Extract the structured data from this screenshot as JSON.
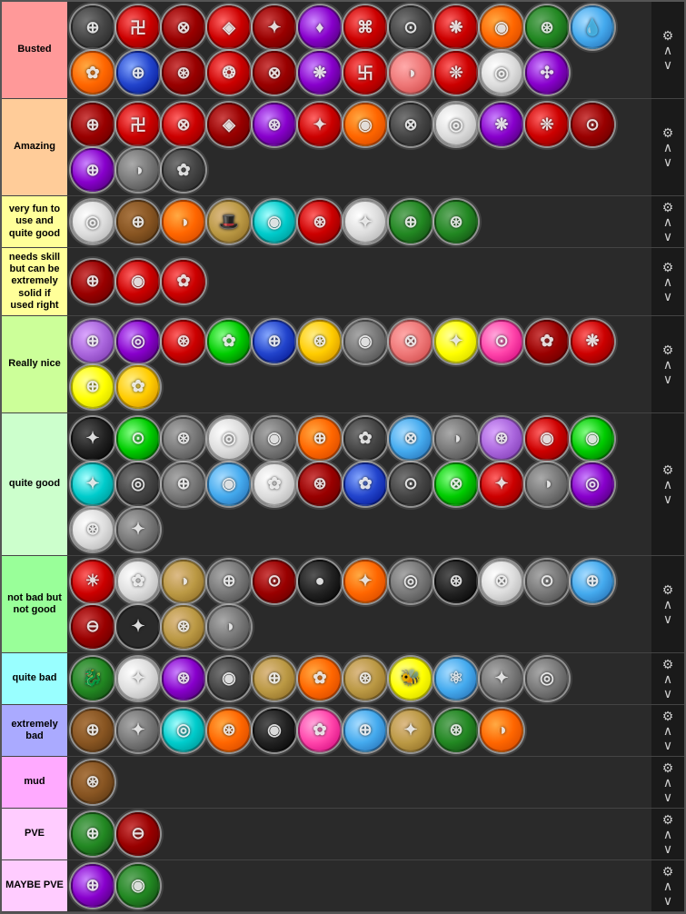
{
  "tiers": [
    {
      "id": "busted",
      "label": "Busted",
      "color": "#ff9999",
      "icons": [
        {
          "color": "ic-darkgray",
          "symbol": "⊕",
          "gear": true
        },
        {
          "color": "ic-red",
          "symbol": "卍",
          "gear": true
        },
        {
          "color": "ic-darkred",
          "symbol": "⊗",
          "gear": true
        },
        {
          "color": "ic-red",
          "symbol": "◈",
          "gear": true
        },
        {
          "color": "ic-darkred",
          "symbol": "✦",
          "gear": true
        },
        {
          "color": "ic-purple",
          "symbol": "♦",
          "gear": true
        },
        {
          "color": "ic-red",
          "symbol": "⌘",
          "gear": true
        },
        {
          "color": "ic-darkgray",
          "symbol": "⊙",
          "gear": true
        },
        {
          "color": "ic-red",
          "symbol": "❋",
          "gear": true
        },
        {
          "color": "ic-orange",
          "symbol": "◉",
          "gear": true
        },
        {
          "color": "ic-darkgreen",
          "symbol": "⊛",
          "gear": true
        },
        {
          "color": "ic-lightblue",
          "symbol": "💧",
          "gear": true
        },
        {
          "color": "ic-orange",
          "symbol": "✿",
          "gear": true
        },
        {
          "color": "ic-blue",
          "symbol": "⊕",
          "gear": true
        },
        {
          "color": "ic-darkred",
          "symbol": "⊛",
          "gear": true
        },
        {
          "color": "ic-red",
          "symbol": "❂",
          "gear": true
        },
        {
          "color": "ic-darkred",
          "symbol": "⊗",
          "gear": true
        },
        {
          "color": "ic-purple",
          "symbol": "❋",
          "gear": true
        },
        {
          "color": "ic-red",
          "symbol": "卐",
          "gear": true
        },
        {
          "color": "ic-salmon",
          "symbol": "◑",
          "gear": true
        },
        {
          "color": "ic-red",
          "symbol": "❊",
          "gear": true
        },
        {
          "color": "ic-white",
          "symbol": "◎",
          "gear": true
        },
        {
          "color": "ic-purple",
          "symbol": "✣",
          "gear": true
        }
      ]
    },
    {
      "id": "amazing",
      "label": "Amazing",
      "color": "#ffcc99",
      "icons": [
        {
          "color": "ic-darkred",
          "symbol": "⊕",
          "gear": true
        },
        {
          "color": "ic-red",
          "symbol": "卍",
          "gear": true
        },
        {
          "color": "ic-red",
          "symbol": "⊗",
          "gear": true
        },
        {
          "color": "ic-darkred",
          "symbol": "◈",
          "gear": true
        },
        {
          "color": "ic-purple",
          "symbol": "⊛",
          "gear": true
        },
        {
          "color": "ic-red",
          "symbol": "✦",
          "gear": true
        },
        {
          "color": "ic-orange",
          "symbol": "◉",
          "gear": true
        },
        {
          "color": "ic-darkgray",
          "symbol": "⊗",
          "gear": true
        },
        {
          "color": "ic-white",
          "symbol": "◎",
          "gear": true
        },
        {
          "color": "ic-purple",
          "symbol": "❋",
          "gear": true
        },
        {
          "color": "ic-red",
          "symbol": "❊",
          "gear": true
        },
        {
          "color": "ic-darkred",
          "symbol": "⊙",
          "gear": true
        },
        {
          "color": "ic-purple",
          "symbol": "⊕",
          "gear": true
        },
        {
          "color": "ic-gray",
          "symbol": "◑",
          "gear": true
        },
        {
          "color": "ic-darkgray",
          "symbol": "✿",
          "gear": true
        }
      ]
    },
    {
      "id": "very-fun",
      "label": "very fun to use and quite good",
      "color": "#ffff99",
      "icons": [
        {
          "color": "ic-white",
          "symbol": "◎",
          "gear": true
        },
        {
          "color": "ic-brown",
          "symbol": "⊕",
          "gear": true
        },
        {
          "color": "ic-orange",
          "symbol": "◑",
          "gear": true
        },
        {
          "color": "ic-tan",
          "symbol": "🎩",
          "gear": true
        },
        {
          "color": "ic-cyan",
          "symbol": "◉",
          "gear": true
        },
        {
          "color": "ic-red",
          "symbol": "⊛",
          "gear": true
        },
        {
          "color": "ic-white",
          "symbol": "✦",
          "gear": true
        },
        {
          "color": "ic-darkgreen",
          "symbol": "⊕",
          "gear": true
        },
        {
          "color": "ic-darkgreen",
          "symbol": "⊛",
          "gear": true
        }
      ]
    },
    {
      "id": "needs-skill",
      "label": "needs skill but can be extremely solid if used right",
      "color": "#ffff99",
      "icons": [
        {
          "color": "ic-darkred",
          "symbol": "⊕",
          "gear": true
        },
        {
          "color": "ic-red",
          "symbol": "◉",
          "gear": true
        },
        {
          "color": "ic-red",
          "symbol": "✿",
          "gear": true
        }
      ]
    },
    {
      "id": "really-nice",
      "label": "Really nice",
      "color": "#ccff99",
      "icons": [
        {
          "color": "ic-lavender",
          "symbol": "⊕",
          "gear": true
        },
        {
          "color": "ic-purple",
          "symbol": "◎",
          "gear": true
        },
        {
          "color": "ic-red",
          "symbol": "⊛",
          "gear": true
        },
        {
          "color": "ic-green",
          "symbol": "✿",
          "gear": true
        },
        {
          "color": "ic-blue",
          "symbol": "⊕",
          "gear": true
        },
        {
          "color": "ic-gold",
          "symbol": "⊛",
          "gear": true
        },
        {
          "color": "ic-gray",
          "symbol": "◉",
          "gear": true
        },
        {
          "color": "ic-salmon",
          "symbol": "⊗",
          "gear": true
        },
        {
          "color": "ic-yellow",
          "symbol": "✦",
          "gear": true
        },
        {
          "color": "ic-pink",
          "symbol": "⊙",
          "gear": true
        },
        {
          "color": "ic-darkred",
          "symbol": "✿",
          "gear": true
        },
        {
          "color": "ic-red",
          "symbol": "❋",
          "gear": true
        },
        {
          "color": "ic-yellow",
          "symbol": "⊕",
          "gear": true
        },
        {
          "color": "ic-gold",
          "symbol": "✿",
          "gear": true
        }
      ]
    },
    {
      "id": "quite-good",
      "label": "quite good",
      "color": "#ccffcc",
      "icons": [
        {
          "color": "ic-black",
          "symbol": "✦",
          "gear": true
        },
        {
          "color": "ic-green",
          "symbol": "⊙",
          "gear": true
        },
        {
          "color": "ic-gray",
          "symbol": "⊛",
          "gear": true
        },
        {
          "color": "ic-white",
          "symbol": "◎",
          "gear": true
        },
        {
          "color": "ic-gray",
          "symbol": "◉",
          "gear": true
        },
        {
          "color": "ic-orange",
          "symbol": "⊕",
          "gear": true
        },
        {
          "color": "ic-darkgray",
          "symbol": "✿",
          "gear": true
        },
        {
          "color": "ic-lightblue",
          "symbol": "⊗",
          "gear": true
        },
        {
          "color": "ic-gray",
          "symbol": "◑",
          "gear": true
        },
        {
          "color": "ic-lavender",
          "symbol": "⊛",
          "gear": true
        },
        {
          "color": "ic-red",
          "symbol": "◉",
          "gear": true
        },
        {
          "color": "ic-green",
          "symbol": "◉",
          "gear": true
        },
        {
          "color": "ic-cyan",
          "symbol": "✦",
          "gear": true
        },
        {
          "color": "ic-darkgray",
          "symbol": "◎",
          "gear": true
        },
        {
          "color": "ic-gray",
          "symbol": "⊕",
          "gear": true
        },
        {
          "color": "ic-lightblue",
          "symbol": "◉",
          "gear": true
        },
        {
          "color": "ic-white",
          "symbol": "✿",
          "gear": true
        },
        {
          "color": "ic-darkred",
          "symbol": "⊛",
          "gear": true
        },
        {
          "color": "ic-blue",
          "symbol": "✿",
          "gear": true
        },
        {
          "color": "ic-darkgray",
          "symbol": "⊙",
          "gear": true
        },
        {
          "color": "ic-green",
          "symbol": "⊗",
          "gear": true
        },
        {
          "color": "ic-red",
          "symbol": "✦",
          "gear": true
        },
        {
          "color": "ic-gray",
          "symbol": "◑",
          "gear": true
        },
        {
          "color": "ic-purple",
          "symbol": "◎",
          "gear": true
        },
        {
          "color": "ic-white",
          "symbol": "⊛",
          "gear": true
        },
        {
          "color": "ic-gray",
          "symbol": "✦",
          "gear": true
        }
      ]
    },
    {
      "id": "not-bad",
      "label": "not bad but not good",
      "color": "#99ff99",
      "icons": [
        {
          "color": "ic-red",
          "symbol": "☀",
          "gear": true
        },
        {
          "color": "ic-white",
          "symbol": "✿",
          "gear": true
        },
        {
          "color": "ic-tan",
          "symbol": "◑",
          "gear": true
        },
        {
          "color": "ic-gray",
          "symbol": "⊕",
          "gear": true
        },
        {
          "color": "ic-darkred",
          "symbol": "⊙",
          "gear": true
        },
        {
          "color": "ic-black",
          "symbol": "●",
          "gear": true
        },
        {
          "color": "ic-orange",
          "symbol": "✦",
          "gear": true
        },
        {
          "color": "ic-gray",
          "symbol": "◎",
          "gear": true
        },
        {
          "color": "ic-black",
          "symbol": "⊛",
          "gear": true
        },
        {
          "color": "ic-white",
          "symbol": "⊗",
          "gear": true
        },
        {
          "color": "ic-gray",
          "symbol": "⊙",
          "gear": true
        },
        {
          "color": "ic-lightblue",
          "symbol": "⊕",
          "gear": true
        },
        {
          "color": "ic-darkred",
          "symbol": "⊖",
          "gear": true
        },
        {
          "color": "ic-darkbrown",
          "symbol": "✦",
          "gear": true
        },
        {
          "color": "ic-tan",
          "symbol": "⊛",
          "gear": true
        },
        {
          "color": "ic-gray",
          "symbol": "◑",
          "gear": true
        }
      ]
    },
    {
      "id": "quite-bad",
      "label": "quite bad",
      "color": "#99ffff",
      "icons": [
        {
          "color": "ic-darkgreen",
          "symbol": "🐉",
          "gear": true
        },
        {
          "color": "ic-white",
          "symbol": "✦",
          "gear": true
        },
        {
          "color": "ic-purple",
          "symbol": "⊛",
          "gear": true
        },
        {
          "color": "ic-darkgray",
          "symbol": "◉",
          "gear": true
        },
        {
          "color": "ic-tan",
          "symbol": "⊕",
          "gear": true
        },
        {
          "color": "ic-orange",
          "symbol": "✿",
          "gear": true
        },
        {
          "color": "ic-tan",
          "symbol": "⊛",
          "gear": true
        },
        {
          "color": "ic-yellow",
          "symbol": "🐝",
          "gear": true
        },
        {
          "color": "ic-lightblue",
          "symbol": "⚛",
          "gear": true
        },
        {
          "color": "ic-gray",
          "symbol": "✦",
          "gear": true
        },
        {
          "color": "ic-gray",
          "symbol": "◎",
          "gear": true
        }
      ]
    },
    {
      "id": "extremely-bad",
      "label": "extremely bad",
      "color": "#aaaaff",
      "icons": [
        {
          "color": "ic-brown",
          "symbol": "⊕",
          "gear": true
        },
        {
          "color": "ic-gray",
          "symbol": "✦",
          "gear": true
        },
        {
          "color": "ic-cyan",
          "symbol": "◎",
          "gear": true
        },
        {
          "color": "ic-orange",
          "symbol": "⊛",
          "gear": true
        },
        {
          "color": "ic-black",
          "symbol": "◉",
          "gear": true
        },
        {
          "color": "ic-pink",
          "symbol": "✿",
          "gear": true
        },
        {
          "color": "ic-lightblue",
          "symbol": "⊕",
          "gear": true
        },
        {
          "color": "ic-tan",
          "symbol": "✦",
          "gear": true
        },
        {
          "color": "ic-darkgreen",
          "symbol": "⊛",
          "gear": true
        },
        {
          "color": "ic-orange",
          "symbol": "◑",
          "gear": true
        }
      ]
    },
    {
      "id": "mud",
      "label": "mud",
      "color": "#ffaaff",
      "icons": [
        {
          "color": "ic-brown",
          "symbol": "⊛",
          "gear": true
        }
      ]
    },
    {
      "id": "pve",
      "label": "PVE",
      "color": "#ffccff",
      "icons": [
        {
          "color": "ic-darkgreen",
          "symbol": "⊕",
          "gear": true
        },
        {
          "color": "ic-darkred",
          "symbol": "⊖",
          "gear": true
        }
      ]
    },
    {
      "id": "maybe-pve",
      "label": "MAYBE PVE",
      "color": "#ffccff",
      "icons": [
        {
          "color": "ic-purple",
          "symbol": "⊕",
          "gear": true
        },
        {
          "color": "ic-darkgreen",
          "symbol": "◉",
          "gear": true
        }
      ]
    }
  ],
  "controls": {
    "gear_symbol": "⚙",
    "up_symbol": "^",
    "down_symbol": "v"
  }
}
